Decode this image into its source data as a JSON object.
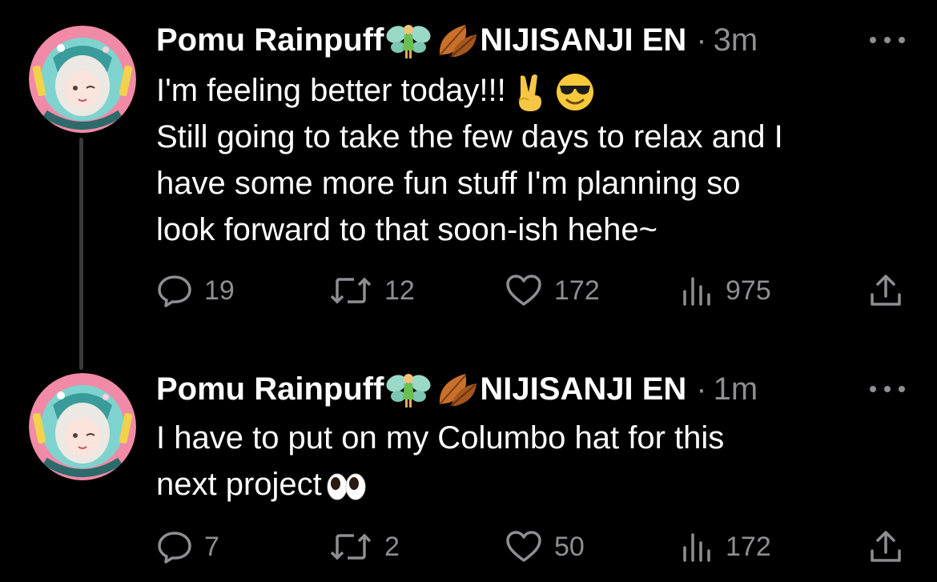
{
  "tweets": [
    {
      "author": {
        "display_name": "Pomu Rainpuff",
        "name_suffix": "NIJISANJI EN",
        "name_emojis": [
          "fairy-emoji",
          "fallen-leaf-emoji"
        ]
      },
      "separator": "·",
      "time": "3m",
      "body_lines": [
        "I'm feeling better today!!!",
        "Still going to take the few days to relax and I",
        "have some more fun stuff I'm planning so",
        "look forward to that soon-ish hehe~"
      ],
      "body_emojis": [
        "victory-hand-emoji",
        "sunglasses-face-emoji"
      ],
      "stats": {
        "replies": "19",
        "retweets": "12",
        "likes": "172",
        "views": "975"
      }
    },
    {
      "author": {
        "display_name": "Pomu Rainpuff",
        "name_suffix": "NIJISANJI EN",
        "name_emojis": [
          "fairy-emoji",
          "fallen-leaf-emoji"
        ]
      },
      "separator": "·",
      "time": "1m",
      "body_lines": [
        "I have to put on my Columbo hat for this",
        "next project"
      ],
      "body_emojis": [
        "eyes-emoji"
      ],
      "stats": {
        "replies": "7",
        "retweets": "2",
        "likes": "50",
        "views": "172"
      }
    }
  ],
  "icons": {
    "reply": "reply-icon",
    "retweet": "retweet-icon",
    "like": "heart-icon",
    "views": "views-chart-icon",
    "share": "share-icon",
    "more": "more-dots-icon"
  },
  "colors": {
    "background": "#000000",
    "text": "#ffffff",
    "secondary": "#8e8e93",
    "thread_line": "#3a3a3c"
  }
}
